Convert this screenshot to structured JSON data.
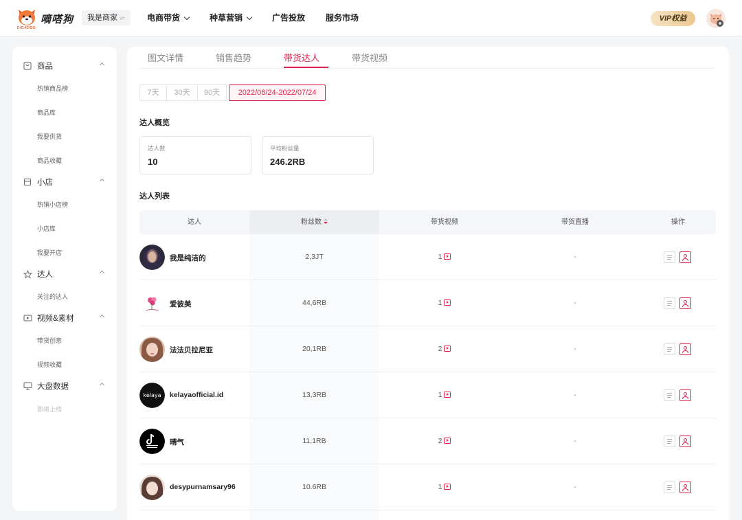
{
  "header": {
    "brand": "嘀嗒狗",
    "brand_sub": "DIDADOG",
    "role": "我是商家",
    "role_swap": "⇌",
    "nav": [
      {
        "label": "电商带货",
        "dropdown": true
      },
      {
        "label": "种草营销",
        "dropdown": true
      },
      {
        "label": "广告投放",
        "dropdown": false
      },
      {
        "label": "服务市场",
        "dropdown": false
      }
    ],
    "vip_label": "VIP权益"
  },
  "sidebar": {
    "groups": [
      {
        "label": "商品",
        "icon": "product-icon",
        "items": [
          "热销商品榜",
          "商品库",
          "我要供货",
          "商品收藏"
        ]
      },
      {
        "label": "小店",
        "icon": "shop-icon",
        "items": [
          "热销小店榜",
          "小店库",
          "我要开店"
        ]
      },
      {
        "label": "达人",
        "icon": "star-icon",
        "items": [
          "关注的达人"
        ]
      },
      {
        "label": "视频&素材",
        "icon": "video-icon",
        "items": [
          "带货创意",
          "视频收藏"
        ]
      },
      {
        "label": "大盘数据",
        "icon": "monitor-icon",
        "items": [
          "即将上线"
        ]
      }
    ]
  },
  "tabs": [
    "图文详情",
    "销售趋势",
    "带货达人",
    "带货视频"
  ],
  "active_tab": "带货达人",
  "date_filter": {
    "options": [
      "7天",
      "30天",
      "90天"
    ],
    "selected_range": "2022/06/24-2022/07/24"
  },
  "overview": {
    "title": "达人概览",
    "stats": [
      {
        "label": "达人数",
        "value": "10"
      },
      {
        "label": "平均粉丝量",
        "value": "246.2RB"
      }
    ]
  },
  "list": {
    "title": "达人列表",
    "columns": [
      "达人",
      "粉丝数",
      "带货视频",
      "带货直播",
      "操作"
    ],
    "sorted_column": "粉丝数",
    "rows": [
      {
        "name": "我是纯洁的",
        "fans": "2,3JT",
        "videos": "1",
        "live": "-"
      },
      {
        "name": "爱彼美",
        "fans": "44,6RB",
        "videos": "1",
        "live": "-"
      },
      {
        "name": "法法贝拉尼亚",
        "fans": "20,1RB",
        "videos": "2",
        "live": "-"
      },
      {
        "name": "kelayaofficial.id",
        "fans": "13,3RB",
        "videos": "1",
        "live": "-"
      },
      {
        "name": "晴气",
        "fans": "11,1RB",
        "videos": "2",
        "live": "-"
      },
      {
        "name": "desypurnamsary96",
        "fans": "10.6RB",
        "videos": "1",
        "live": "-"
      }
    ]
  },
  "colors": {
    "accent": "#e5214b",
    "brand_orange": "#e0632a"
  }
}
